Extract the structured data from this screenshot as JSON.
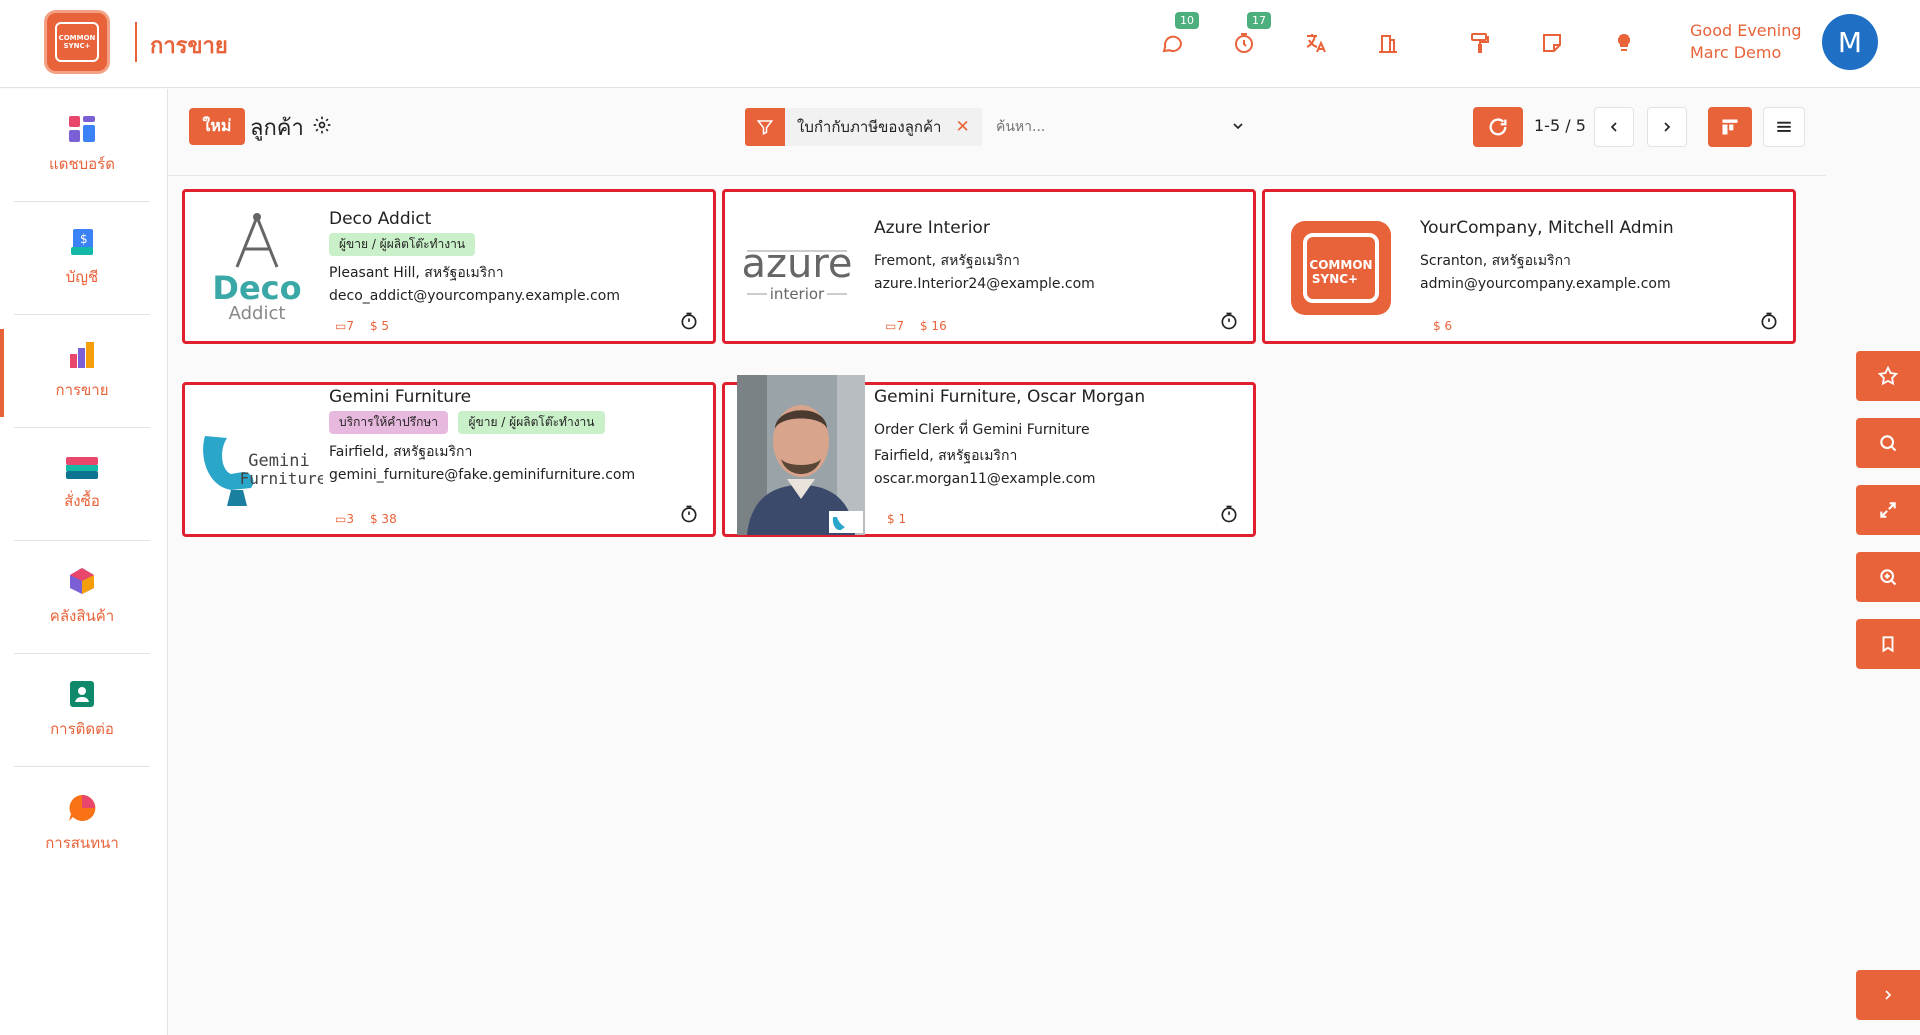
{
  "header": {
    "logo_text": "COMMON SYNC+",
    "app_title": "การขาย",
    "icons": [
      {
        "name": "chat-icon",
        "badge": "10"
      },
      {
        "name": "activity-timer-icon",
        "badge": "17"
      },
      {
        "name": "translate-icon",
        "badge": ""
      },
      {
        "name": "company-icon",
        "badge": ""
      },
      {
        "name": "paint-roller-icon",
        "badge": ""
      },
      {
        "name": "sticky-note-icon",
        "badge": ""
      },
      {
        "name": "lightbulb-icon",
        "badge": ""
      }
    ],
    "greeting_line1": "Good Evening",
    "greeting_line2": "Marc Demo",
    "avatar_initial": "M"
  },
  "sidebar": {
    "items": [
      {
        "label": "แดชบอร์ด",
        "icon": "dashboard-icon"
      },
      {
        "label": "บัญชี",
        "icon": "accounting-icon"
      },
      {
        "label": "การขาย",
        "icon": "sales-icon",
        "active": true
      },
      {
        "label": "สั่งซื้อ",
        "icon": "purchase-icon"
      },
      {
        "label": "คลังสินค้า",
        "icon": "inventory-icon"
      },
      {
        "label": "การติดต่อ",
        "icon": "contacts-icon"
      },
      {
        "label": "การสนทนา",
        "icon": "discuss-icon"
      }
    ]
  },
  "control": {
    "new_label": "ใหม่",
    "breadcrumb": "ลูกค้า",
    "filter_facet": "ใบกำกับภาษีของลูกค้า",
    "search_placeholder": "ค้นหา...",
    "pager": "1-5 / 5"
  },
  "cards": [
    {
      "name": "Deco Addict",
      "tags": [
        {
          "text": "ผู้ขาย / ผู้ผลิตโต๊ะทำงาน",
          "color": "green"
        }
      ],
      "lines": [
        "Pleasant Hill, สหรัฐอเมริกา",
        "deco_addict@yourcompany.example.com"
      ],
      "invoices": "7",
      "amount": "$ 5",
      "logo_word": "Deco",
      "logo_sub": "Addict"
    },
    {
      "name": "Azure Interior",
      "tags": [],
      "lines": [
        "Fremont, สหรัฐอเมริกา",
        "azure.Interior24@example.com"
      ],
      "invoices": "7",
      "amount": "$ 16",
      "logo_word": "azure",
      "logo_sub": "interior"
    },
    {
      "name": "YourCompany, Mitchell Admin",
      "tags": [],
      "lines": [
        "Scranton, สหรัฐอเมริกา",
        "admin@yourcompany.example.com"
      ],
      "invoices": "",
      "amount": "$ 6",
      "logo_word": "COMMON",
      "logo_sub": "SYNC+"
    },
    {
      "name": "Gemini Furniture",
      "tags": [
        {
          "text": "บริการให้คำปรึกษา",
          "color": "pink"
        },
        {
          "text": "ผู้ขาย / ผู้ผลิตโต๊ะทำงาน",
          "color": "green"
        }
      ],
      "lines": [
        "Fairfield, สหรัฐอเมริกา",
        "gemini_furniture@fake.geminifurniture.com"
      ],
      "invoices": "3",
      "amount": "$ 38",
      "logo_word": "Gemini",
      "logo_sub": "Furniture"
    },
    {
      "name": "Gemini Furniture, Oscar Morgan",
      "tags": [],
      "lines": [
        "Order Clerk ที่ Gemini Furniture",
        "Fairfield, สหรัฐอเมริกา",
        "oscar.morgan11@example.com"
      ],
      "invoices": "",
      "amount": "$ 1",
      "logo_word": "",
      "logo_sub": ""
    }
  ],
  "right_rail": [
    "star-icon",
    "search-icon",
    "expand-icon",
    "zoom-in-icon",
    "bookmark-icon",
    "chevron-right-icon"
  ],
  "colors": {
    "accent": "#e8633a",
    "card_border": "#e0202e",
    "avatar": "#1f6fc4"
  }
}
